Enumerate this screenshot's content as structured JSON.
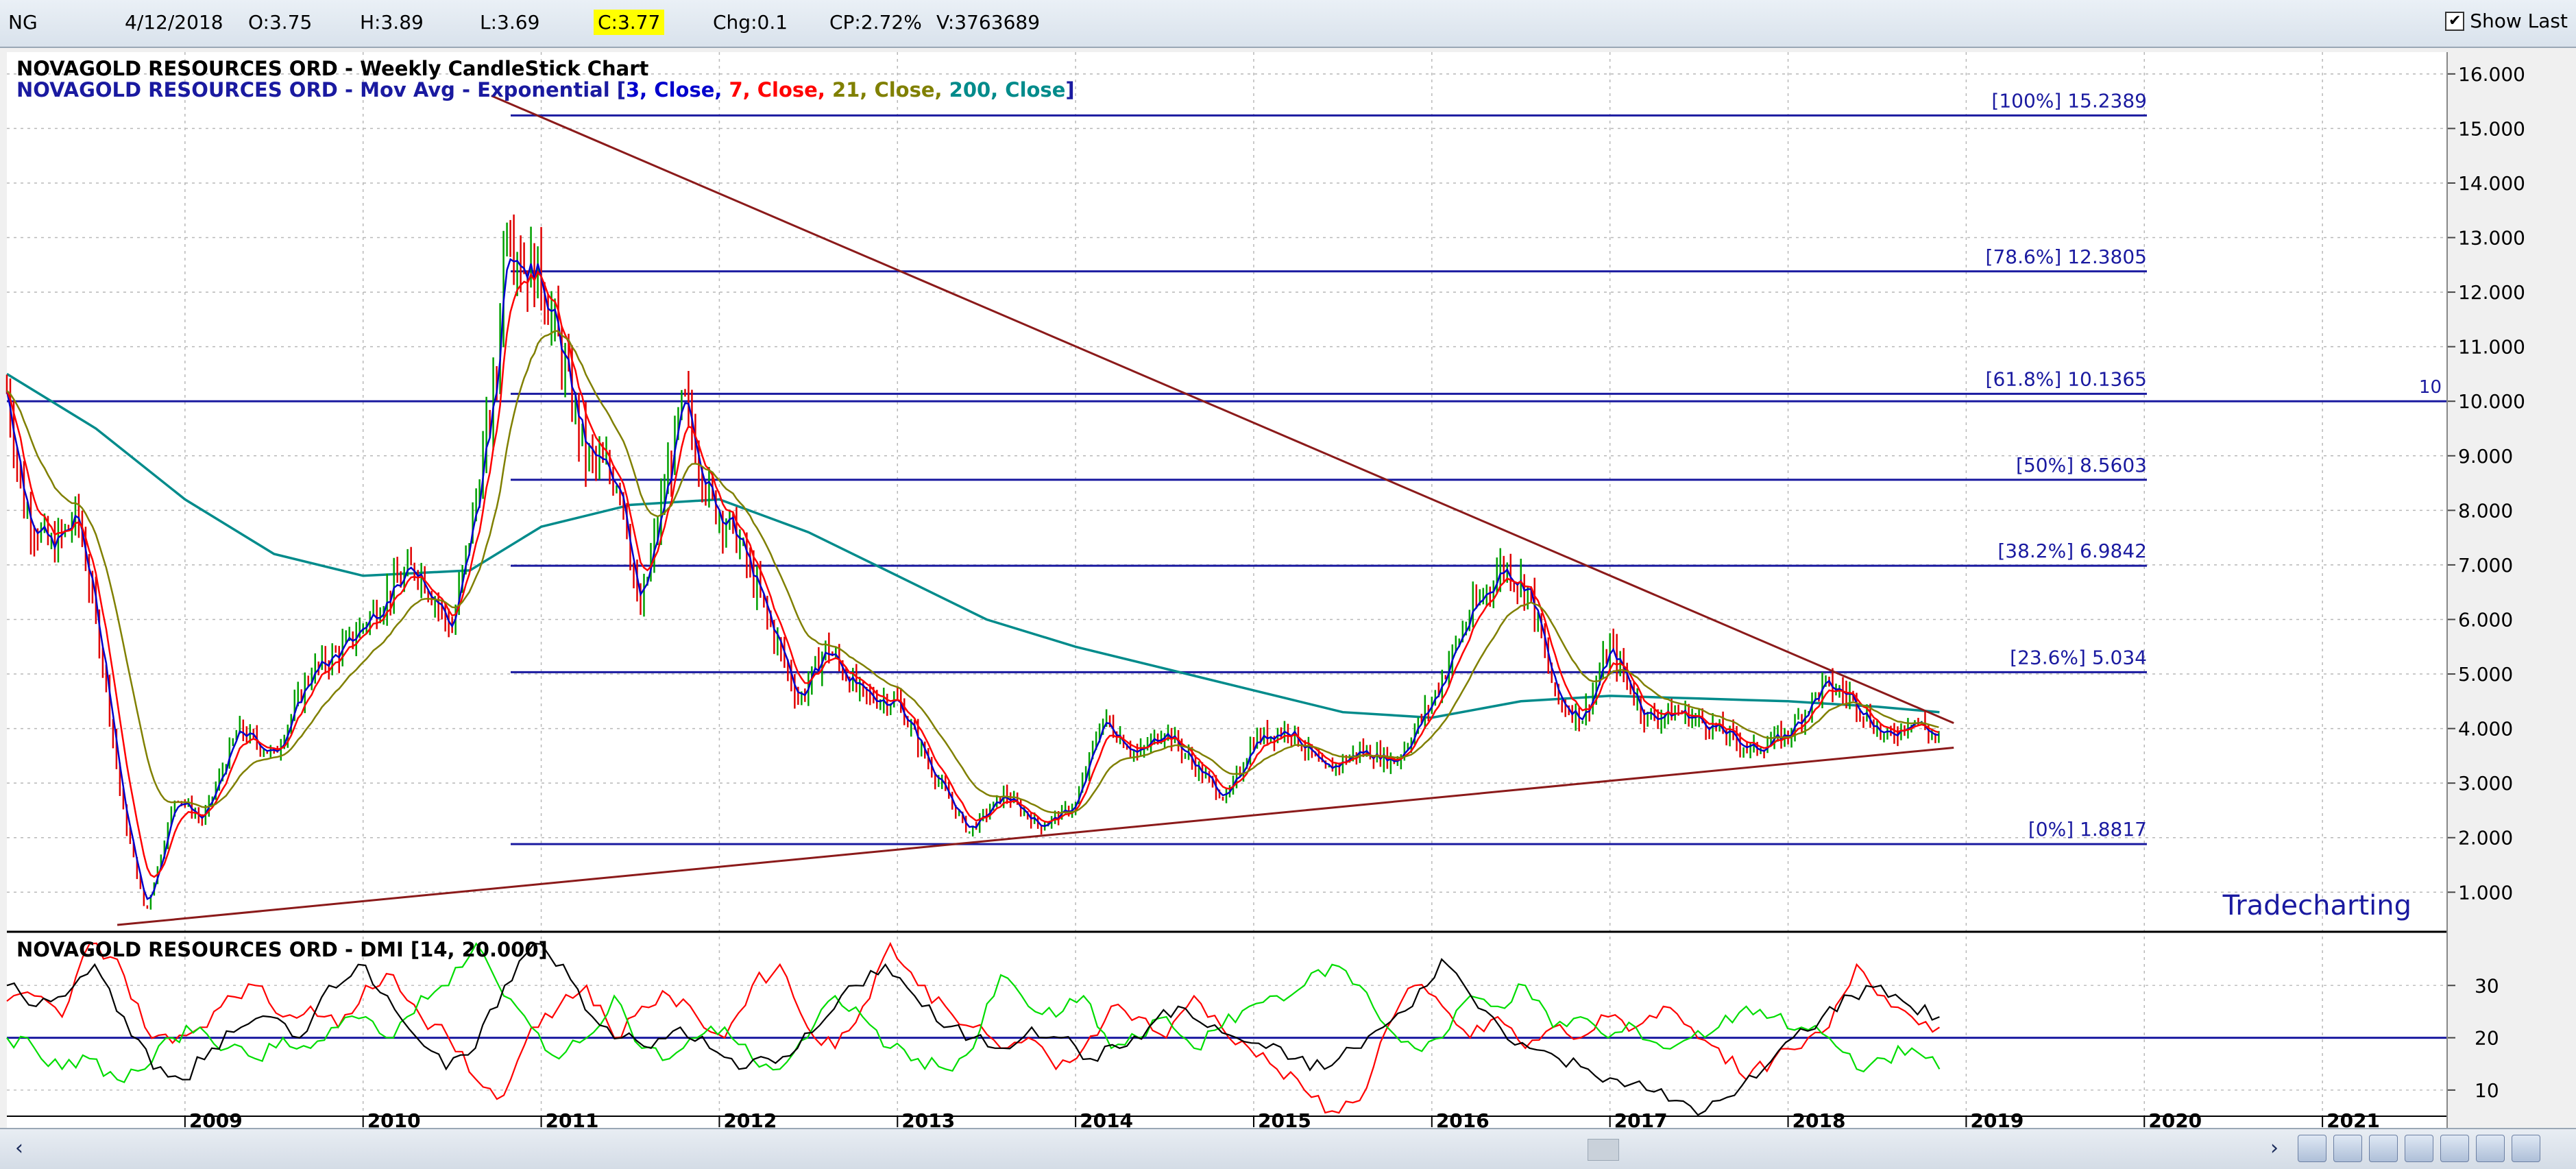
{
  "header": {
    "symbol": "NG",
    "date": "4/12/2018",
    "open": "O:3.75",
    "high": "H:3.89",
    "low": "L:3.69",
    "close": "C:3.77",
    "change": "Chg:0.1",
    "change_pct": "CP:2.72%",
    "volume": "V:3763689",
    "show_last_label": "Show Last",
    "show_last_checked": "✔"
  },
  "chart_data": [
    {
      "type": "candlestick",
      "title": "NOVAGOLD RESOURCES ORD - Weekly CandleStick Chart",
      "subtitle_prefix": "NOVAGOLD RESOURCES ORD - Mov Avg - Exponential [",
      "ma_legend": [
        {
          "text": "3, Close, ",
          "color": "#0000cc"
        },
        {
          "text": "7, Close, ",
          "color": "#ff0000"
        },
        {
          "text": "21, Close, ",
          "color": "#808000"
        },
        {
          "text": "200, Close",
          "color": "#008b8b"
        }
      ],
      "subtitle_suffix": "]",
      "y_ticks": [
        "1.000",
        "2.000",
        "3.000",
        "4.000",
        "5.000",
        "6.000",
        "7.000",
        "8.000",
        "9.000",
        "10.000",
        "11.000",
        "12.000",
        "13.000",
        "14.000",
        "15.000",
        "16.000"
      ],
      "ylim": [
        0.3,
        16.4
      ],
      "x_ticks": [
        "2009",
        "2010",
        "2011",
        "2012",
        "2013",
        "2014",
        "2015",
        "2016",
        "2017",
        "2018",
        "2019",
        "2020",
        "2021"
      ],
      "xlim": [
        2008.0,
        2021.7
      ],
      "horizontal_line": {
        "value": 10,
        "label": "10"
      },
      "fib_levels": [
        {
          "label": "[100%] 15.2389",
          "value": 15.2389
        },
        {
          "label": "[78.6%] 12.3805",
          "value": 12.3805
        },
        {
          "label": "[61.8%] 10.1365",
          "value": 10.1365
        },
        {
          "label": "[50%] 8.5603",
          "value": 8.5603
        },
        {
          "label": "[38.2%] 6.9842",
          "value": 6.9842
        },
        {
          "label": "[23.6%] 5.034",
          "value": 5.034
        },
        {
          "label": "[0%] 1.8817",
          "value": 1.8817
        }
      ],
      "trendlines": [
        {
          "from": [
            2010.72,
            15.6
          ],
          "to": [
            2018.93,
            4.1
          ]
        },
        {
          "from": [
            2008.62,
            0.4
          ],
          "to": [
            2018.93,
            3.65
          ]
        }
      ],
      "price_path": [
        [
          2008.0,
          10.2
        ],
        [
          2008.1,
          8.0
        ],
        [
          2008.25,
          7.3
        ],
        [
          2008.4,
          7.9
        ],
        [
          2008.55,
          5.0
        ],
        [
          2008.65,
          2.5
        ],
        [
          2008.78,
          0.6
        ],
        [
          2008.95,
          2.8
        ],
        [
          2009.1,
          2.3
        ],
        [
          2009.3,
          4.0
        ],
        [
          2009.5,
          3.5
        ],
        [
          2009.7,
          5.0
        ],
        [
          2009.9,
          5.5
        ],
        [
          2010.15,
          6.5
        ],
        [
          2010.3,
          7.0
        ],
        [
          2010.5,
          5.8
        ],
        [
          2010.65,
          8.5
        ],
        [
          2010.75,
          10.5
        ],
        [
          2010.8,
          13.5
        ],
        [
          2010.9,
          12.5
        ],
        [
          2011.0,
          12.3
        ],
        [
          2011.1,
          11.0
        ],
        [
          2011.25,
          9.0
        ],
        [
          2011.45,
          8.5
        ],
        [
          2011.55,
          6.0
        ],
        [
          2011.7,
          8.5
        ],
        [
          2011.8,
          10.0
        ],
        [
          2011.95,
          8.2
        ],
        [
          2012.1,
          7.5
        ],
        [
          2012.25,
          6.2
        ],
        [
          2012.45,
          4.5
        ],
        [
          2012.6,
          5.5
        ],
        [
          2012.8,
          4.6
        ],
        [
          2013.0,
          4.5
        ],
        [
          2013.2,
          3.2
        ],
        [
          2013.4,
          2.1
        ],
        [
          2013.6,
          2.8
        ],
        [
          2013.8,
          2.2
        ],
        [
          2014.0,
          2.6
        ],
        [
          2014.15,
          4.2
        ],
        [
          2014.35,
          3.5
        ],
        [
          2014.5,
          4.0
        ],
        [
          2014.7,
          3.2
        ],
        [
          2014.85,
          2.7
        ],
        [
          2015.0,
          3.8
        ],
        [
          2015.2,
          4.0
        ],
        [
          2015.4,
          3.2
        ],
        [
          2015.6,
          3.6
        ],
        [
          2015.8,
          3.4
        ],
        [
          2016.0,
          4.5
        ],
        [
          2016.2,
          6.0
        ],
        [
          2016.4,
          7.0
        ],
        [
          2016.55,
          6.5
        ],
        [
          2016.7,
          4.5
        ],
        [
          2016.85,
          4.2
        ],
        [
          2017.0,
          5.5
        ],
        [
          2017.2,
          4.2
        ],
        [
          2017.4,
          4.3
        ],
        [
          2017.6,
          4.0
        ],
        [
          2017.8,
          3.6
        ],
        [
          2018.0,
          3.9
        ],
        [
          2018.2,
          4.8
        ],
        [
          2018.35,
          4.6
        ],
        [
          2018.55,
          3.8
        ],
        [
          2018.7,
          4.2
        ],
        [
          2018.85,
          3.77
        ]
      ],
      "ema200_path": [
        [
          2008.0,
          10.5
        ],
        [
          2008.5,
          9.5
        ],
        [
          2009.0,
          8.2
        ],
        [
          2009.5,
          7.2
        ],
        [
          2010.0,
          6.8
        ],
        [
          2010.6,
          6.9
        ],
        [
          2011.0,
          7.7
        ],
        [
          2011.5,
          8.1
        ],
        [
          2012.0,
          8.2
        ],
        [
          2012.5,
          7.6
        ],
        [
          2013.0,
          6.8
        ],
        [
          2013.5,
          6.0
        ],
        [
          2014.0,
          5.5
        ],
        [
          2014.5,
          5.1
        ],
        [
          2015.0,
          4.7
        ],
        [
          2015.5,
          4.3
        ],
        [
          2016.0,
          4.2
        ],
        [
          2016.5,
          4.5
        ],
        [
          2017.0,
          4.6
        ],
        [
          2017.5,
          4.55
        ],
        [
          2018.0,
          4.5
        ],
        [
          2018.5,
          4.4
        ],
        [
          2018.85,
          4.3
        ]
      ]
    },
    {
      "type": "line",
      "title": "NOVAGOLD RESOURCES ORD - DMI [14, 20.000]",
      "y_ticks": [
        "10",
        "20",
        "30"
      ],
      "ylim": [
        5,
        40
      ],
      "horizontal_line": {
        "value": 20
      },
      "series": [
        {
          "color": "#ff0000",
          "values": [
            27,
            28,
            24,
            38,
            35,
            22,
            19,
            22,
            28,
            30,
            24,
            26,
            22,
            30,
            32,
            24,
            20,
            12,
            9,
            22,
            26,
            30,
            20,
            26,
            28,
            24,
            20,
            30,
            34,
            22,
            18,
            26,
            38,
            30,
            26,
            22,
            18,
            20,
            14,
            18,
            26,
            24,
            20,
            28,
            22,
            18,
            14,
            10,
            6,
            8,
            22,
            30,
            26,
            20,
            24,
            18,
            22,
            20,
            24,
            22,
            26,
            22,
            18,
            12,
            16,
            18,
            22,
            34,
            28,
            24,
            22
          ]
        },
        {
          "color": "#00dd00",
          "values": [
            20,
            18,
            14,
            16,
            12,
            14,
            20,
            22,
            18,
            16,
            20,
            18,
            22,
            24,
            20,
            28,
            30,
            38,
            28,
            22,
            16,
            20,
            28,
            18,
            16,
            20,
            22,
            16,
            14,
            20,
            28,
            24,
            18,
            16,
            14,
            18,
            32,
            26,
            24,
            28,
            18,
            20,
            24,
            18,
            22,
            26,
            28,
            30,
            34,
            30,
            22,
            18,
            20,
            28,
            26,
            30,
            22,
            24,
            20,
            22,
            18,
            20,
            22,
            26,
            24,
            22,
            20,
            14,
            16,
            18,
            14
          ]
        },
        {
          "color": "#000000",
          "values": [
            30,
            26,
            28,
            34,
            24,
            14,
            12,
            18,
            22,
            24,
            20,
            30,
            34,
            28,
            20,
            14,
            18,
            30,
            38,
            34,
            24,
            20,
            18,
            22,
            18,
            14,
            16,
            18,
            24,
            30,
            34,
            28,
            22,
            20,
            18,
            22,
            20,
            16,
            18,
            22,
            26,
            22,
            20,
            18,
            16,
            14,
            18,
            22,
            26,
            35,
            28,
            22,
            18,
            16,
            14,
            12,
            10,
            8,
            6,
            9,
            14,
            20,
            24,
            28,
            30,
            26,
            24
          ]
        }
      ]
    }
  ],
  "watermark": "Tradecharting",
  "nav": {
    "scroll_left": "‹",
    "scroll_right": "›",
    "buttons": [
      "zoom-in",
      "zoom-out",
      "print",
      "fit",
      "first",
      "prev",
      "next"
    ]
  }
}
